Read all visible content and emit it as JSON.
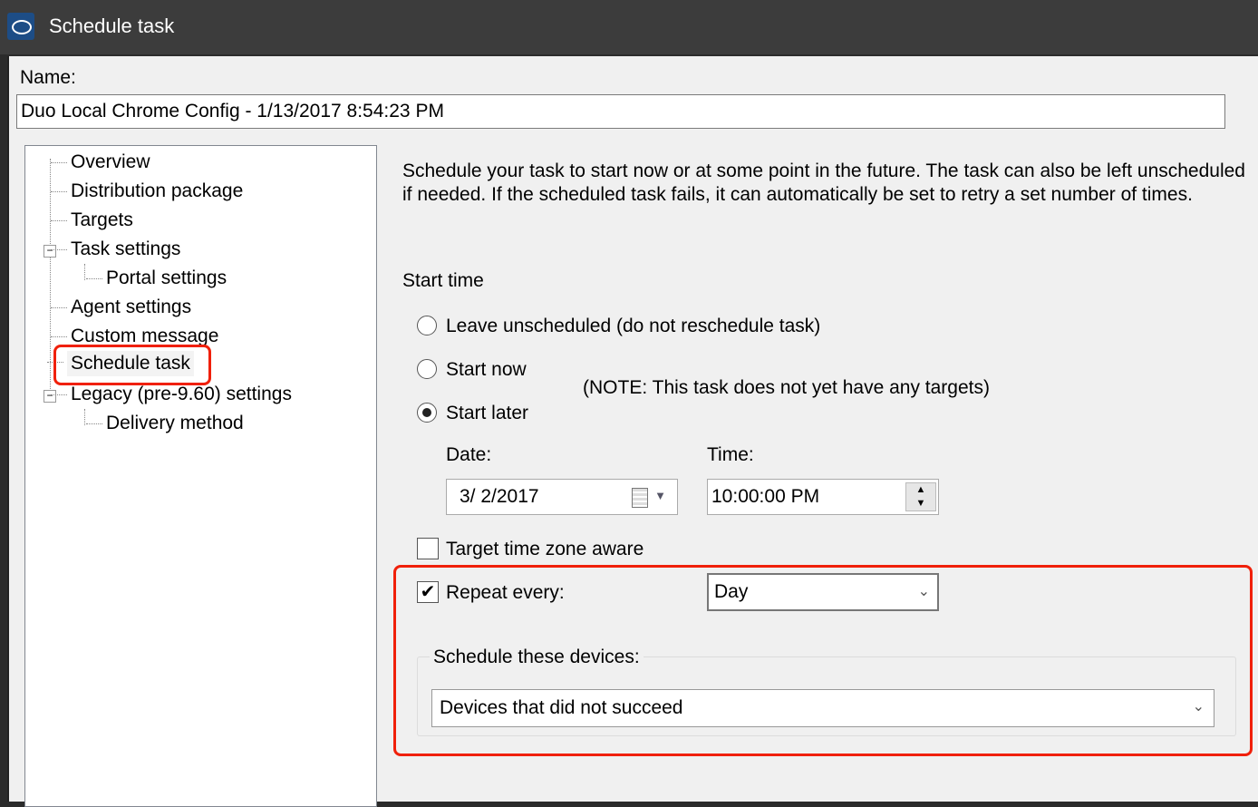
{
  "window": {
    "title": "Schedule task",
    "icon": "app-cloud-icon"
  },
  "name_label": "Name:",
  "name_value": "Duo Local Chrome Config - 1/13/2017 8:54:23 PM",
  "tree": [
    {
      "label": "Overview"
    },
    {
      "label": "Distribution package"
    },
    {
      "label": "Targets"
    },
    {
      "label": "Task settings",
      "expander": "minus"
    },
    {
      "label": "Portal settings"
    },
    {
      "label": "Agent settings"
    },
    {
      "label": "Custom message"
    },
    {
      "label": "Schedule task",
      "selected": true
    },
    {
      "label": "Legacy (pre-9.60) settings",
      "expander": "minus"
    },
    {
      "label": "Delivery method"
    }
  ],
  "description": "Schedule your task to start now or at some point in the future.  The task can also be left unscheduled if needed.  If the scheduled task fails, it can automatically be set to retry a set number of times.",
  "start_time": {
    "label": "Start time",
    "options": [
      {
        "label": "Leave unscheduled (do not reschedule task)",
        "selected": false
      },
      {
        "label": "Start now",
        "selected": false
      },
      {
        "label": "Start later",
        "selected": true
      }
    ],
    "note": "(NOTE: This task does not yet have any targets)"
  },
  "date": {
    "label": "Date:",
    "value": "3/  2/2017"
  },
  "time": {
    "label": "Time:",
    "value": "10:00:00 PM"
  },
  "tz_aware": {
    "label": "Target time zone aware",
    "checked": false
  },
  "repeat": {
    "label": "Repeat every:",
    "checked": true,
    "value": "Day"
  },
  "devices": {
    "label": "Schedule these devices:",
    "value": "Devices that did not succeed"
  },
  "highlight_color": "#f0200a"
}
